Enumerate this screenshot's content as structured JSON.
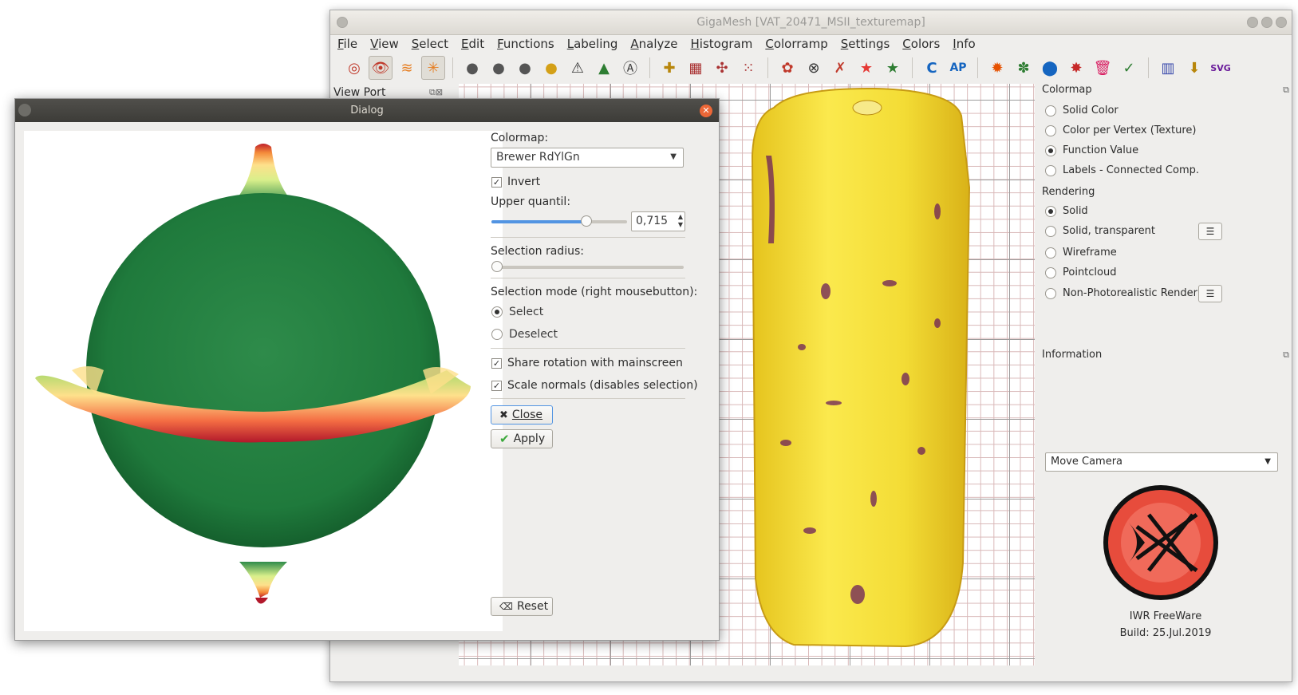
{
  "main_window": {
    "title": "GigaMesh [VAT_20471_MSII_texturemap]"
  },
  "menu": [
    "File",
    "View",
    "Select",
    "Edit",
    "Functions",
    "Labeling",
    "Analyze",
    "Histogram",
    "Colorramp",
    "Settings",
    "Colors",
    "Info"
  ],
  "dock": {
    "viewport_title": "View Port"
  },
  "toolbar_glyphs": [
    "◎",
    "👁",
    "≋",
    "✳",
    "●",
    "●",
    "●",
    "●",
    "⚠",
    "▲",
    "Ⓐ",
    "✚",
    "▦",
    "✣",
    "⁙",
    "✿",
    "⊗",
    "✗",
    "★",
    "★",
    "C",
    "AP",
    "✹",
    "✽",
    "⬤",
    "✸",
    "🗑",
    "✓",
    "▥",
    "⬇",
    "SVG"
  ],
  "right_panel": {
    "colormap_title": "Colormap",
    "colormap_options": [
      "Solid Color",
      "Color per Vertex (Texture)",
      "Function Value",
      "Labels - Connected Comp."
    ],
    "colormap_selected": 2,
    "rendering_title": "Rendering",
    "rendering_options": [
      "Solid",
      "Solid, transparent",
      "Wireframe",
      "Pointcloud",
      "Non-Photorealistic Rendering"
    ],
    "rendering_selected": 0,
    "information_title": "Information",
    "mode_combo": "Move Camera",
    "logo_caption": "IWR FreeWare",
    "build": "Build: 25.Jul.2019"
  },
  "dialog": {
    "title": "Dialog",
    "colormap_label": "Colormap:",
    "colormap_value": "Brewer RdYlGn",
    "invert_label": "Invert",
    "invert_checked": true,
    "upper_quantil_label": "Upper quantil:",
    "upper_quantil_value": "0,715",
    "upper_quantil_level": 0.715,
    "selection_radius_label": "Selection radius:",
    "selection_radius_level": 0.0,
    "selection_mode_label": "Selection mode (right mousebutton):",
    "select_label": "Select",
    "deselect_label": "Deselect",
    "share_rotation_label": "Share rotation with mainscreen",
    "scale_normals_label": "Scale normals (disables selection)",
    "close_label": "Close",
    "apply_label": "Apply",
    "reset_label": "Reset"
  },
  "colors": {
    "accent_orange": "#ec6737",
    "green": "#1e7a3e",
    "yellow": "#f3e03a"
  }
}
